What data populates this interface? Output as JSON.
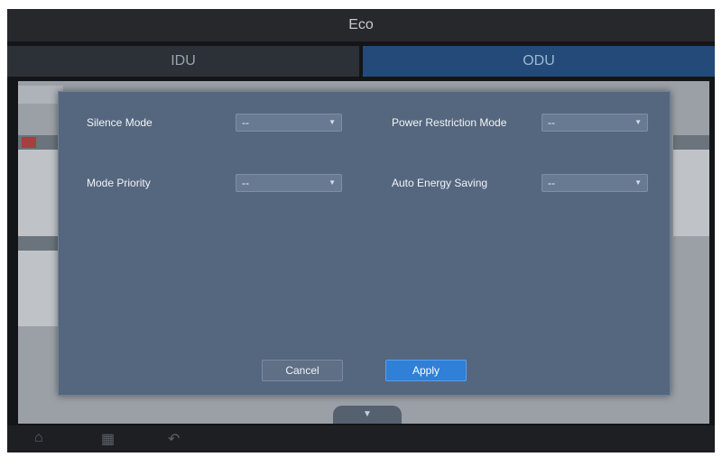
{
  "window": {
    "title": "Eco"
  },
  "tabs": [
    {
      "label": "IDU"
    },
    {
      "label": "ODU"
    }
  ],
  "dialog": {
    "fields": [
      {
        "label": "Silence Mode",
        "value": "--"
      },
      {
        "label": "Power Restriction Mode",
        "value": "--"
      },
      {
        "label": "Mode Priority",
        "value": "--"
      },
      {
        "label": "Auto Energy Saving",
        "value": "--"
      }
    ],
    "cancel_label": "Cancel",
    "apply_label": "Apply"
  },
  "colors": {
    "dialog_bg": "#55677f",
    "apply_bg": "#2f80d6",
    "odu_tab_bg": "#234a78"
  },
  "icons": {
    "home": "home-icon",
    "grid": "grid-icon",
    "back": "back-icon",
    "expand": "chevron-down-icon",
    "dropdown": "caret-down-icon"
  }
}
